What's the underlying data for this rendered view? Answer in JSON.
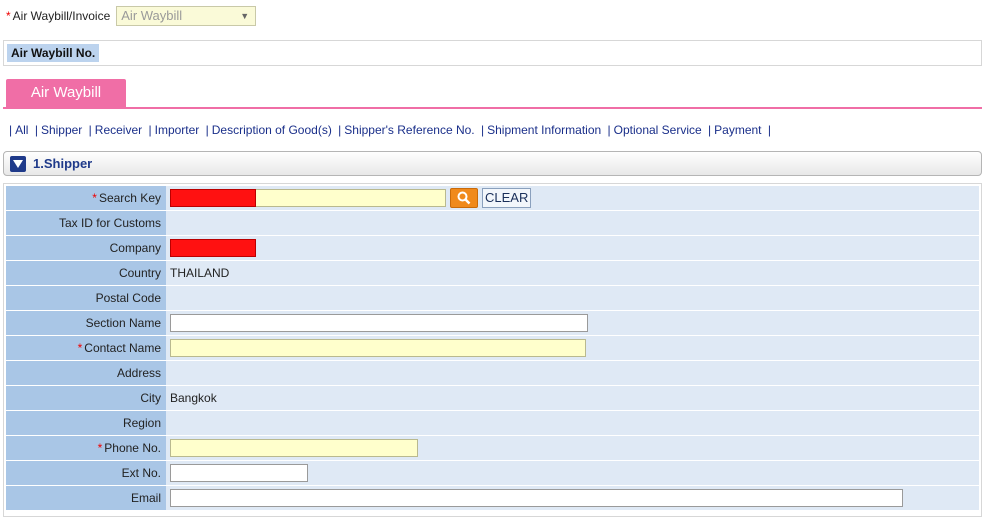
{
  "top": {
    "label": "Air Waybill/Invoice",
    "required_mark": "*",
    "select_value": "Air Waybill"
  },
  "awb": {
    "label": "Air Waybill No."
  },
  "tabs": [
    {
      "label": "Air Waybill"
    }
  ],
  "nav": [
    "All",
    "Shipper",
    "Receiver",
    "Importer",
    "Description of Good(s)",
    "Shipper's Reference No.",
    "Shipment Information",
    "Optional Service",
    "Payment"
  ],
  "nav_sep": "|",
  "section": {
    "title": "1.Shipper"
  },
  "buttons": {
    "clear": "CLEAR"
  },
  "fields": {
    "search_key": "Search Key",
    "tax_id": "Tax ID for Customs",
    "company": "Company",
    "country": "Country",
    "country_value": "THAILAND",
    "postal_code": "Postal Code",
    "section_name": "Section Name",
    "contact_name": "Contact Name",
    "address": "Address",
    "city": "City",
    "city_value": "Bangkok",
    "region": "Region",
    "phone": "Phone No.",
    "ext": "Ext No.",
    "email": "Email"
  },
  "colors": {
    "tab_pink": "#f06ea6",
    "label_blue": "#a9c6e6",
    "value_blue": "#dfe9f5",
    "link_navy": "#1a2f8a",
    "required_red": "#e00000",
    "redacted": "#ff1111"
  },
  "icons": {
    "search": "search-icon",
    "section_toggle": "triangle-down-icon"
  }
}
